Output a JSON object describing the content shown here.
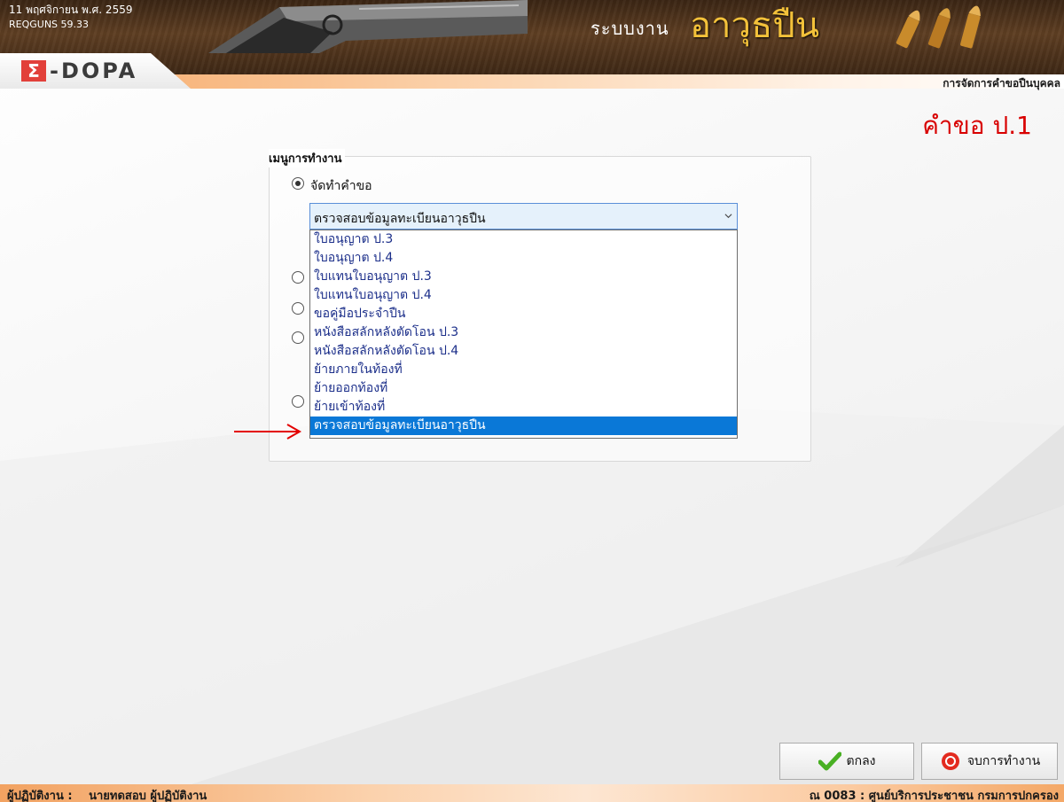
{
  "header": {
    "date": "11 พฤศจิกายน พ.ศ. 2559",
    "version": "REQGUNS 59.33",
    "system_label": "ระบบงาน",
    "system_title": "อาวุธปืน",
    "logo_text": "-DOPA",
    "logo_symbol": "Σ",
    "subtitle": "การจัดการคำขอปืนบุคคล"
  },
  "page": {
    "title": "คำขอ ป.1"
  },
  "menu": {
    "legend": "เมนูการทำงาน",
    "option_make_request": "จัดทำคำขอ",
    "combo_value": "ตรวจสอบข้อมูลทะเบียนอาวุธปืน",
    "dropdown_items": [
      "ใบอนุญาต ป.3",
      "ใบอนุญาต ป.4",
      "ใบแทนใบอนุญาต ป.3",
      "ใบแทนใบอนุญาต ป.4",
      "ขอคู่มือประจำปืน",
      "หนังสือสลักหลังตัดโอน ป.3",
      "หนังสือสลักหลังตัดโอน ป.4",
      "ย้ายภายในท้องที่",
      "ย้ายออกท้องที่",
      "ย้ายเข้าท้องที่",
      "ตรวจสอบข้อมูลทะเบียนอาวุธปืน"
    ],
    "selected_index": 10
  },
  "buttons": {
    "ok": "ตกลง",
    "exit": "จบการทำงาน"
  },
  "footer": {
    "operator_label": "ผู้ปฏิบัติงาน :",
    "operator_name": "นายทดสอบ ผู้ปฏิบัติงาน",
    "location": "ณ 0083 : ศูนย์บริการประชาชน กรมการปกครอง"
  },
  "colors": {
    "title_red": "#d80000",
    "selection_blue": "#0a78d7",
    "header_gold": "#f3c13a",
    "footer_orange": "#f2a261"
  }
}
